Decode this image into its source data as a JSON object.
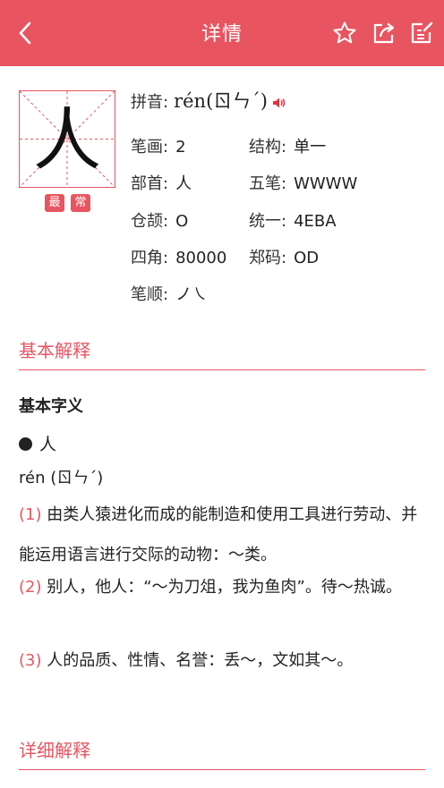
{
  "header": {
    "title": "详情",
    "back_icon": "chevron-left-icon",
    "favorite_icon": "star-icon",
    "share_icon": "share-icon",
    "edit_icon": "edit-icon",
    "bg_color": "#e85560"
  },
  "character": {
    "glyph": "人",
    "tags": [
      "最",
      "常"
    ]
  },
  "info": {
    "pinyin_label": "拼音:",
    "pinyin_value": "rén(ㄖㄣˊ)",
    "strokes_label": "笔画:",
    "strokes_value": "2",
    "structure_label": "结构:",
    "structure_value": "单一",
    "radical_label": "部首:",
    "radical_value": "人",
    "wubi_label": "五笔:",
    "wubi_value": "WWWW",
    "cangjie_label": "仓颉:",
    "cangjie_value": "O",
    "unicode_label": "统一:",
    "unicode_value": "4EBA",
    "sijiao_label": "四角:",
    "sijiao_value": "80000",
    "zhengma_label": "郑码:",
    "zhengma_value": "OD",
    "order_label": "笔顺:",
    "order_value": "ノ㇏"
  },
  "basic": {
    "section_title": "基本解释",
    "subtitle": "基本字义",
    "bullet_char": "人",
    "pronunciation": "rén (ㄖㄣˊ)",
    "definitions": [
      {
        "num": "(1)",
        "text": " 由类人猿进化而成的能制造和使用工具进行劳动、并能运用语言进行交际的动物：～类。"
      },
      {
        "num": "(2)",
        "text": " 别人，他人：“～为刀俎，我为鱼肉”。待～热诚。"
      },
      {
        "num": "(3)",
        "text": " 人的品质、性情、名誉：丢～，文如其～。"
      }
    ]
  },
  "detail": {
    "section_title": "详细解释"
  },
  "colors": {
    "accent": "#e85560"
  }
}
